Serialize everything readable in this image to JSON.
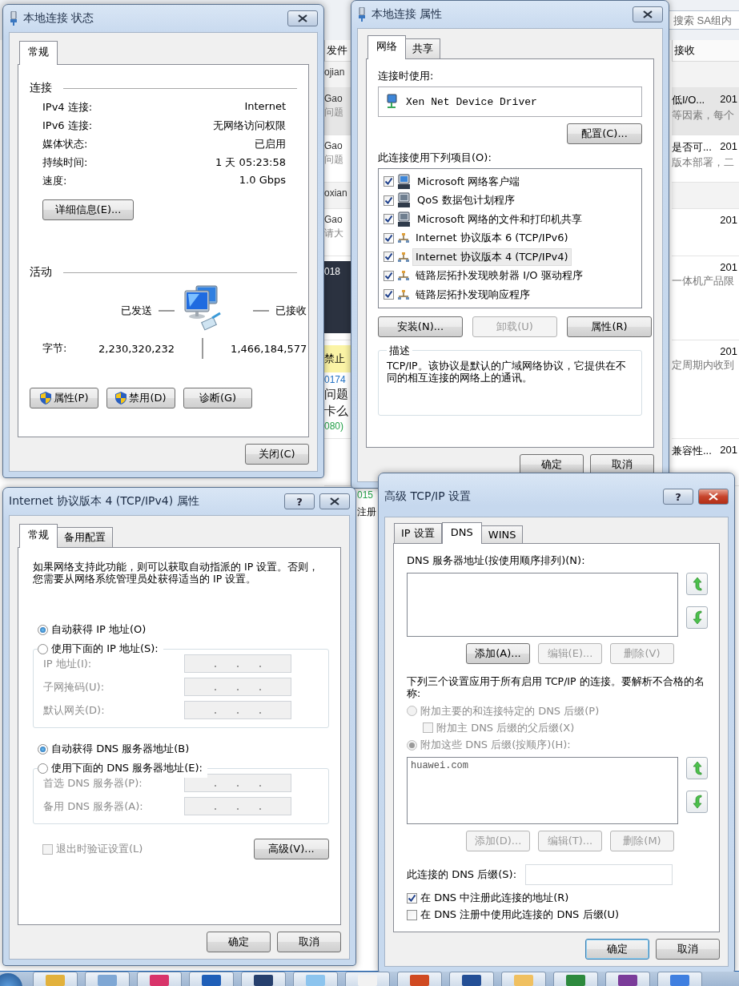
{
  "background_app": {
    "search": {
      "placeholder": "搜索 SA组内"
    },
    "columns": {
      "left": "发件",
      "right": "接收"
    },
    "rows": [
      {
        "kind": "group",
        "left": [
          {
            "text": "ojian",
            "kind": "sender"
          }
        ]
      },
      {
        "kind": "message",
        "shaded": true,
        "left": [
          {
            "text": "Gao",
            "kind": "sender"
          },
          {
            "text": "问题",
            "kind": "snippet"
          }
        ],
        "right": {
          "subject": "低I/O...",
          "date": "201",
          "preview": "等因素，每个"
        }
      },
      {
        "kind": "message",
        "shaded": false,
        "left": [
          {
            "text": "Gao",
            "kind": "sender"
          },
          {
            "text": "问题",
            "kind": "snippet"
          }
        ],
        "right": {
          "subject": "是否可...",
          "date": "201",
          "preview": "版本部署，二"
        }
      },
      {
        "kind": "group",
        "left": [
          {
            "text": "oxian",
            "kind": "sender"
          }
        ]
      },
      {
        "kind": "message",
        "shaded": false,
        "left": [
          {
            "text": "Gao",
            "kind": "sender"
          },
          {
            "text": "请大",
            "kind": "snippet"
          }
        ],
        "right": {
          "date": "201"
        }
      },
      {
        "kind": "message",
        "shaded": false,
        "left": [
          {
            "text": "018",
            "kind": "image"
          }
        ],
        "right": {
          "date": "201",
          "preview": "一体机产品限"
        }
      },
      {
        "kind": "message",
        "shaded": false,
        "left": [
          {
            "text": "禁止",
            "kind": "banner"
          },
          {
            "text": "0174",
            "kind": "id"
          },
          {
            "text": "问题",
            "kind": "title"
          },
          {
            "text": "卡么",
            "kind": "title"
          },
          {
            "text": "080)",
            "kind": "tag"
          }
        ],
        "right": {
          "date": "201",
          "preview": "定周期内收到"
        }
      },
      {
        "kind": "message",
        "shaded": false,
        "left": [],
        "right": {
          "subject": "兼容性...",
          "date": "201"
        }
      }
    ],
    "lower_fragments": [
      {
        "text": "015",
        "kind": "tag"
      },
      {
        "text": "注册",
        "kind": "title"
      }
    ]
  },
  "status_window": {
    "title": "本地连接 状态",
    "tabs": [
      {
        "label": "常规",
        "selected": true
      }
    ],
    "connection": {
      "heading": "连接",
      "rows": [
        {
          "label": "IPv4 连接:",
          "value": "Internet"
        },
        {
          "label": "IPv6 连接:",
          "value": "无网络访问权限"
        },
        {
          "label": "媒体状态:",
          "value": "已启用"
        },
        {
          "label": "持续时间:",
          "value": "1 天 05:23:58"
        },
        {
          "label": "速度:",
          "value": "1.0 Gbps"
        }
      ],
      "details_button": "详细信息(E)..."
    },
    "activity": {
      "heading": "活动",
      "sent_label": "已发送",
      "received_label": "已接收",
      "bytes_label": "字节:",
      "sent": "2,230,320,232",
      "received": "1,466,184,577"
    },
    "buttons": [
      {
        "label": "属性(P)",
        "shield": true
      },
      {
        "label": "禁用(D)",
        "shield": true
      },
      {
        "label": "诊断(G)",
        "shield": false
      }
    ],
    "close_button": "关闭(C)"
  },
  "properties_window": {
    "title": "本地连接 属性",
    "tabs": [
      {
        "label": "网络",
        "selected": true
      },
      {
        "label": "共享",
        "selected": false
      }
    ],
    "connect_using_label": "连接时使用:",
    "adapter": "Xen Net Device Driver",
    "configure_button": "配置(C)...",
    "items_label": "此连接使用下列项目(O):",
    "items": [
      {
        "label": "Microsoft 网络客户端",
        "checked": true,
        "selected": false,
        "kind": "client"
      },
      {
        "label": "QoS 数据包计划程序",
        "checked": true,
        "selected": false,
        "kind": "service"
      },
      {
        "label": "Microsoft 网络的文件和打印机共享",
        "checked": true,
        "selected": false,
        "kind": "service"
      },
      {
        "label": "Internet 协议版本 6 (TCP/IPv6)",
        "checked": true,
        "selected": false,
        "kind": "protocol"
      },
      {
        "label": "Internet 协议版本 4 (TCP/IPv4)",
        "checked": true,
        "selected": true,
        "kind": "protocol"
      },
      {
        "label": "链路层拓扑发现映射器 I/O 驱动程序",
        "checked": true,
        "selected": false,
        "kind": "protocol"
      },
      {
        "label": "链路层拓扑发现响应程序",
        "checked": true,
        "selected": false,
        "kind": "protocol"
      }
    ],
    "item_buttons": [
      {
        "label": "安装(N)...",
        "disabled": false
      },
      {
        "label": "卸载(U)",
        "disabled": true
      },
      {
        "label": "属性(R)",
        "disabled": false
      }
    ],
    "description": {
      "heading": "描述",
      "text": "TCP/IP。该协议是默认的广域网络协议，它提供在不同的相互连接的网络上的通讯。"
    },
    "footer_buttons": [
      "确定",
      "取消"
    ]
  },
  "ipv4_window": {
    "title": "Internet 协议版本 4 (TCP/IPv4) 属性",
    "help_button": "?",
    "tabs": [
      {
        "label": "常规",
        "selected": true
      },
      {
        "label": "备用配置",
        "selected": false
      }
    ],
    "intro": "如果网络支持此功能，则可以获取自动指派的 IP 设置。否则，您需要从网络系统管理员处获得适当的 IP 设置。",
    "ip_options": [
      {
        "label": "自动获得 IP 地址(O)",
        "selected": true
      },
      {
        "label": "使用下面的 IP 地址(S):",
        "selected": false
      }
    ],
    "ip_fields": [
      {
        "label": "IP 地址(I):",
        "disabled": true
      },
      {
        "label": "子网掩码(U):",
        "disabled": true
      },
      {
        "label": "默认网关(D):",
        "disabled": true
      }
    ],
    "dns_options": [
      {
        "label": "自动获得 DNS 服务器地址(B)",
        "selected": true
      },
      {
        "label": "使用下面的 DNS 服务器地址(E):",
        "selected": false
      }
    ],
    "dns_fields": [
      {
        "label": "首选 DNS 服务器(P):",
        "disabled": true
      },
      {
        "label": "备用 DNS 服务器(A):",
        "disabled": true
      }
    ],
    "validate_checkbox": {
      "label": "退出时验证设置(L)",
      "checked": false
    },
    "advanced_button": "高级(V)...",
    "footer_buttons": [
      "确定",
      "取消"
    ]
  },
  "advanced_window": {
    "title": "高级 TCP/IP 设置",
    "help_button": "?",
    "tabs": [
      {
        "label": "IP 设置",
        "selected": false
      },
      {
        "label": "DNS",
        "selected": true
      },
      {
        "label": "WINS",
        "selected": false
      }
    ],
    "servers_label": "DNS 服务器地址(按使用顺序排列)(N):",
    "server_buttons": [
      {
        "label": "添加(A)...",
        "disabled": false
      },
      {
        "label": "编辑(E)...",
        "disabled": true
      },
      {
        "label": "删除(V)",
        "disabled": true
      }
    ],
    "note": "下列三个设置应用于所有启用 TCP/IP 的连接。要解析不合格的名称:",
    "primary_suffix_option": {
      "label": "附加主要的和连接特定的 DNS 后缀(P)",
      "selected": false,
      "disabled": true
    },
    "parent_suffix_checkbox": {
      "label": "附加主 DNS 后缀的父后缀(X)",
      "checked": false,
      "disabled": true
    },
    "these_suffixes_option": {
      "label": "附加这些 DNS 后缀(按顺序)(H):",
      "selected": true,
      "disabled": true
    },
    "suffixes": [
      "huawei.com"
    ],
    "suffix_buttons": [
      {
        "label": "添加(D)...",
        "disabled": true
      },
      {
        "label": "编辑(T)...",
        "disabled": true
      },
      {
        "label": "删除(M)",
        "disabled": true
      }
    ],
    "connection_suffix_label": "此连接的 DNS 后缀(S):",
    "register_checkboxes": [
      {
        "label": "在 DNS 中注册此连接的地址(R)",
        "checked": true
      },
      {
        "label": "在 DNS 注册中使用此连接的 DNS 后缀(U)",
        "checked": false
      }
    ],
    "footer_buttons": [
      "确定",
      "取消"
    ]
  }
}
